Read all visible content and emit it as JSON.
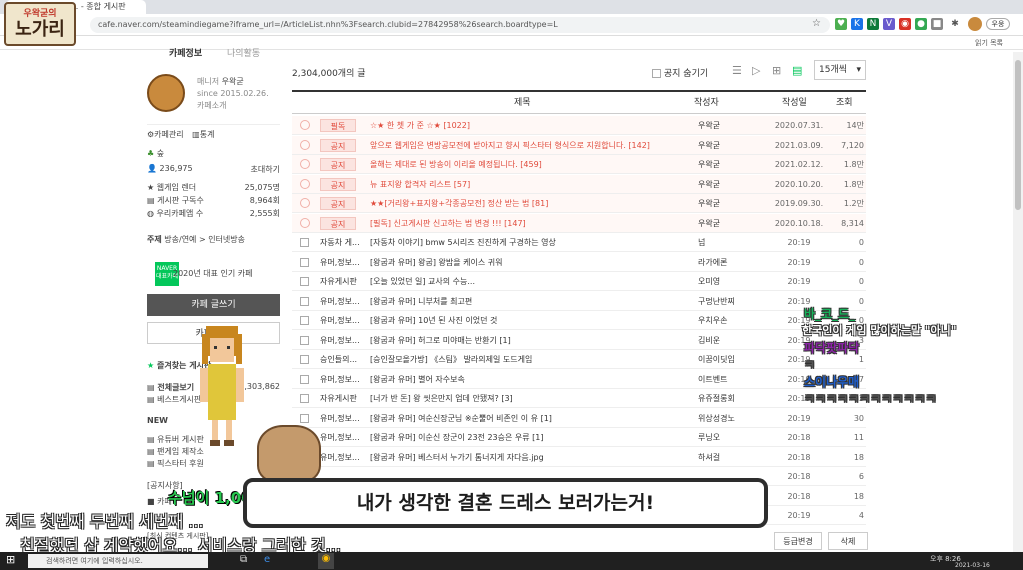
{
  "browser": {
    "tab_title": "인게임 다이어... - 종합 게시판",
    "url": "cafe.naver.com/steamindiegame?iframe_url=/ArticleList.nhn%3Fsearch.clubid=27842958%26search.boardtype=L",
    "bookmark_other": "읽기 목록",
    "profile_label": "우웅"
  },
  "stream_logo": {
    "line1": "우왁굳의",
    "line2": "노가리"
  },
  "sidebar": {
    "tabs": [
      "카페정보",
      "나의활동"
    ],
    "manager_role": "매니저",
    "manager_name": "우왁굳",
    "since": "since 2015.02.26.",
    "cafe_intro": "카페소개",
    "admin": "카페관리",
    "stats": "통계",
    "level": "숲",
    "members": "236,975",
    "invite": "초대하기",
    "stats_rows": [
      {
        "label": "웹게임 렌더",
        "value": "25,075명"
      },
      {
        "label": "게시판 구독수",
        "value": "8,964회"
      },
      {
        "label": "우리카페앱 수",
        "value": "2,555회"
      }
    ],
    "theme_label": "주제",
    "theme_value": "방송/연예 > 인터넷방송",
    "naver_badge": "NAVER 대표카페",
    "award": "2020년 대표 인기 카페",
    "write_button": "카페 글쓰기",
    "chat_button": "카페 채팅",
    "favorites": "즐겨찾는 게시판",
    "all_posts": "전체글보기",
    "all_posts_count": "2,303,862",
    "best": "베스트게시판",
    "new_label": "NEW",
    "new_items": [
      "유튜버 게시판",
      "팬게임 제작소",
      "픽스타터 후원"
    ],
    "notice_section": "[공지사항]",
    "notice_item": "카페",
    "contents_section": "[최신 컨텐츠 게시판]"
  },
  "main": {
    "total": "2,304,000개의 글",
    "hide_notice": "공지 숨기기",
    "per_page": "15개씩",
    "headers": {
      "title": "제목",
      "author": "작성자",
      "date": "작성일",
      "views": "조회"
    },
    "notices": [
      {
        "tag": "필독",
        "title": "☆★ 한 쳇 가 준 ☆★ [1022]",
        "author": "우왁굳",
        "date": "2020.07.31.",
        "views": "14만"
      },
      {
        "tag": "공지",
        "title": "앞으로 웹게임은 변방공모전에 받아지고 향시 픽스타터 형식으로 지원합니다. [142]",
        "author": "우왁굳",
        "date": "2021.03.09.",
        "views": "7,120"
      },
      {
        "tag": "공지",
        "title": "올해는 제대로 된 방송이 이리올 예정됩니다. [459]",
        "author": "우왁굳",
        "date": "2021.02.12.",
        "views": "1.8만"
      },
      {
        "tag": "공지",
        "title": "뉴 표지왕 합격자 리스트 [57]",
        "author": "우왁굳",
        "date": "2020.10.20.",
        "views": "1.8만"
      },
      {
        "tag": "공지",
        "title": "★★[거리왕+표지왕+각종공모전] 정산 받는 법 [81]",
        "author": "우왁굳",
        "date": "2019.09.30.",
        "views": "1.2만"
      },
      {
        "tag": "공지",
        "title": "[필독] 신고게시판 신고하는 법 변경 !!! [147]",
        "author": "우왁굳",
        "date": "2020.10.18.",
        "views": "8,314"
      }
    ],
    "posts": [
      {
        "board": "자동차 게...",
        "title": "[자동차 이야기] bmw 5시리즈 진진하게 구경하는 영상",
        "author": "넘",
        "date": "20:19",
        "views": "0"
      },
      {
        "board": "유머,정보...",
        "title": "[왕굽과 유머] 왕굽] 왕밤을 케이스 귀워",
        "author": "라가에론",
        "date": "20:19",
        "views": "0"
      },
      {
        "board": "자유게시판",
        "title": "[오늘 있었던 일] 교사의 수능...",
        "author": "오미영",
        "date": "20:19",
        "views": "0"
      },
      {
        "board": "유머,정보...",
        "title": "[왕굽과 유머] 니부처를 최고편",
        "author": "구멍난반찌",
        "date": "20:19",
        "views": "0"
      },
      {
        "board": "유머,정보...",
        "title": "[왕굽과 유머] 10년 된 사진 이었던 것",
        "author": "우치우손",
        "date": "20:19",
        "views": "0"
      },
      {
        "board": "유머,정보...",
        "title": "[왕굽과 유머] 허그로 미야매는 반환기 [1]",
        "author": "김비운",
        "date": "20:19",
        "views": "3"
      },
      {
        "board": "승인들의...",
        "title": "[승인잘모올가방] 《스팀》 발라의제일 도드게임",
        "author": "이꿈이딧입",
        "date": "20:19",
        "views": "1"
      },
      {
        "board": "유머,정보...",
        "title": "[왕굽과 유머] 별어 자수보속",
        "author": "이트벤트",
        "date": "20:19",
        "views": "17"
      },
      {
        "board": "자유게시판",
        "title": "[너가 반 돈] 왕 씻은만지 업데 안됐져? [3]",
        "author": "유쥬절롱회",
        "date": "20:19",
        "views": "43"
      },
      {
        "board": "유머,정보...",
        "title": "[왕굽과 유머] 여순신장군님 ※순뿔어 비존인 이 유 [1]",
        "author": "위상성경노",
        "date": "20:19",
        "views": "30"
      },
      {
        "board": "유머,정보...",
        "title": "[왕굽과 유머] 이순신 장군이 23전 23승은 우류 [1]",
        "author": "루닝오",
        "date": "20:18",
        "views": "11"
      },
      {
        "board": "유머,정보...",
        "title": "[왕굽과 유머] 베스터서 누가기 톰너지게 자다음.jpg",
        "author": "하셔걸",
        "date": "20:18",
        "views": "18"
      },
      {
        "board": "",
        "title": "",
        "author": "",
        "date": "20:18",
        "views": "6"
      },
      {
        "board": "",
        "title": "",
        "author": "",
        "date": "20:18",
        "views": "18"
      },
      {
        "board": "",
        "title": "",
        "author": "",
        "date": "20:19",
        "views": "4"
      }
    ],
    "footer_buttons": [
      "등급변경",
      "삭제"
    ]
  },
  "overlay": {
    "chat_lines": [
      {
        "text": "바_코_드_",
        "color": "#17b25a"
      },
      {
        "text": "한국인이 게임 많이하는말 \"아니\"",
        "color": "#ffffff"
      },
      {
        "text": "파닥팟파닥",
        "color": "#8e24aa"
      },
      {
        "text": "ㅋ",
        "color": "#555555"
      },
      {
        "text": "스이나우매",
        "color": "#1e5fd0"
      },
      {
        "text": "ㅋㅋㅋㅋㅋㅋㅋㅋㅋㅋㅋㅋ",
        "color": "#555555"
      }
    ],
    "caption_main": "내가 생각한 결혼 드레스 보러가는거!",
    "caption_sub1": "저도 첫번째 두번째 세번째 ...",
    "caption_sub2": "친절했던 샵 계약했어요... 서비스랑 그러한 것...",
    "caption_green": "수넘이 1,00"
  },
  "taskbar": {
    "search_placeholder": "검색하려면 여기에 입력하십시오.",
    "time": "오후 8:26",
    "date": "2021-03-16"
  }
}
